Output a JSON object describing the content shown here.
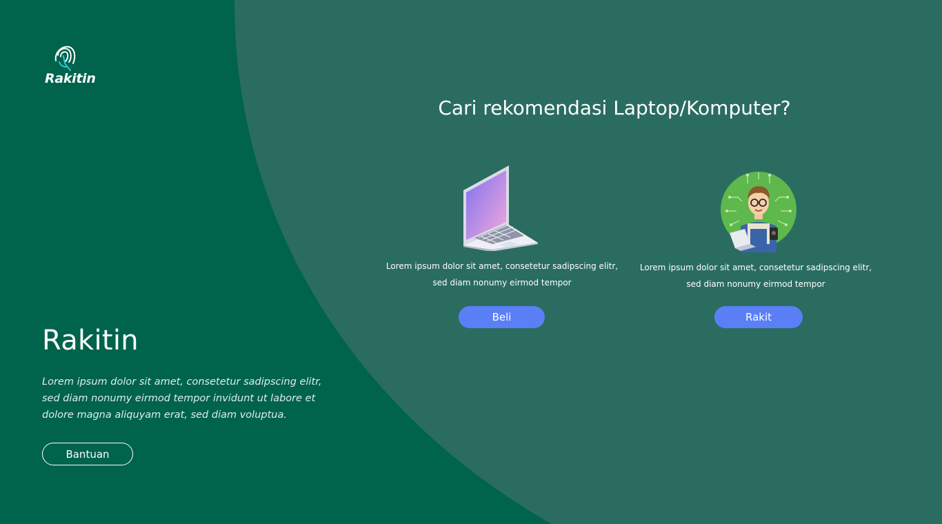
{
  "colors": {
    "left_bg": "#00634c",
    "right_bg": "#2b6c60",
    "button_blue": "#5b7ff6",
    "text_white": "#ffffff"
  },
  "brand": {
    "logo_text": "Rakitin",
    "logo_icon": "fingerprint-icon"
  },
  "sidebar": {
    "title": "Rakitin",
    "description": "Lorem ipsum dolor sit amet, consetetur sadipscing elitr, sed diam nonumy eirmod tempor invidunt ut labore et dolore magna aliquyam erat, sed diam voluptua.",
    "help_button": "Bantuan"
  },
  "main": {
    "heading": "Cari rekomendasi Laptop/Komputer?",
    "options": [
      {
        "icon": "laptop-icon",
        "description": "Lorem ipsum dolor sit amet, consetetur sadipscing elitr, sed diam nonumy eirmod tempor",
        "button": "Beli"
      },
      {
        "icon": "technician-avatar-icon",
        "description": "Lorem ipsum dolor sit amet, consetetur sadipscing elitr, sed diam nonumy eirmod tempor",
        "button": "Rakit"
      }
    ]
  }
}
